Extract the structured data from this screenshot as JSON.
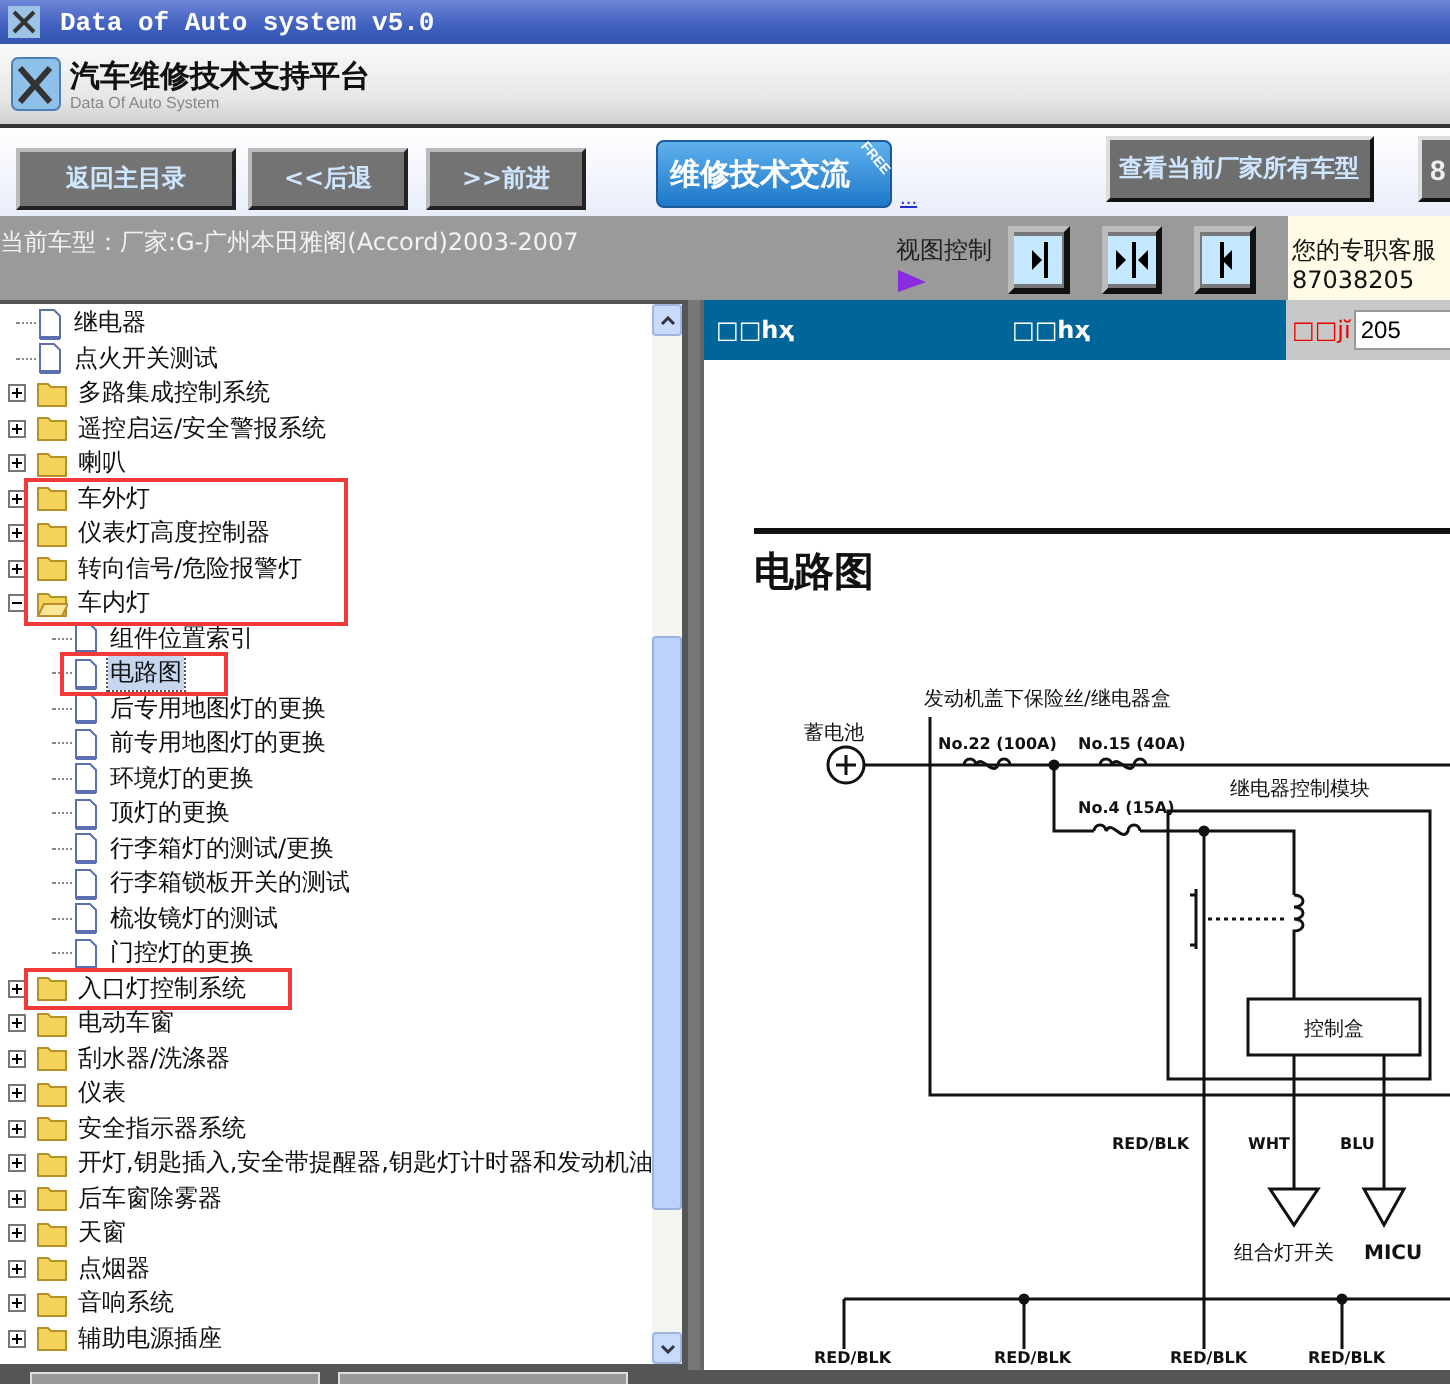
{
  "window": {
    "title": "Data of Auto system v5.0"
  },
  "header": {
    "title": "汽车维修技术支持平台",
    "subtitle": "Data Of Auto System"
  },
  "toolbar": {
    "buttons": [
      {
        "label": "返回主目录",
        "kind": "nav"
      },
      {
        "label": "<<后退",
        "kind": "nav"
      },
      {
        "label": ">>前进",
        "kind": "nav"
      },
      {
        "label": "维修技术交流",
        "kind": "promo",
        "badge": "FREE"
      },
      {
        "label": "...",
        "kind": "link"
      },
      {
        "label": "查看当前厂家所有车型",
        "kind": "wide"
      },
      {
        "label": "8",
        "kind": "cut"
      }
    ]
  },
  "info_bar": {
    "current_model": "当前车型：厂家:G-广州本田雅阁(Accord)2003-2007",
    "view_control_label": "视图控制",
    "view_buttons": [
      {
        "kind": "expand_right"
      },
      {
        "kind": "split"
      },
      {
        "kind": "expand_left"
      }
    ],
    "service": {
      "label": "您的专职客服",
      "phone": "87038205"
    }
  },
  "tree": {
    "items": [
      {
        "label": "继电器",
        "kind": "doc",
        "selected": false,
        "marked": false
      },
      {
        "label": "点火开关测试",
        "kind": "doc",
        "selected": false,
        "marked": false
      },
      {
        "label": "多路集成控制系统",
        "kind": "folder",
        "expanded": false,
        "selected": false,
        "marked": false
      },
      {
        "label": "遥控启运/安全警报系统",
        "kind": "folder",
        "expanded": false,
        "selected": false,
        "marked": false
      },
      {
        "label": "喇叭",
        "kind": "folder",
        "expanded": false,
        "selected": false,
        "marked": false
      },
      {
        "label": "车外灯",
        "kind": "folder",
        "expanded": false,
        "selected": false,
        "marked": true
      },
      {
        "label": "仪表灯高度控制器",
        "kind": "folder",
        "expanded": false,
        "selected": false,
        "marked": true
      },
      {
        "label": "转向信号/危险报警灯",
        "kind": "folder",
        "expanded": false,
        "selected": false,
        "marked": true
      },
      {
        "label": "车内灯",
        "kind": "folder",
        "expanded": true,
        "selected": false,
        "marked": true,
        "children": [
          {
            "label": "组件位置索引",
            "kind": "doc",
            "selected": false,
            "marked": false
          },
          {
            "label": "电路图",
            "kind": "doc",
            "selected": true,
            "marked": true
          },
          {
            "label": "后专用地图灯的更换",
            "kind": "doc",
            "selected": false,
            "marked": false
          },
          {
            "label": "前专用地图灯的更换",
            "kind": "doc",
            "selected": false,
            "marked": false
          },
          {
            "label": "环境灯的更换",
            "kind": "doc",
            "selected": false,
            "marked": false
          },
          {
            "label": "顶灯的更换",
            "kind": "doc",
            "selected": false,
            "marked": false
          },
          {
            "label": "行李箱灯的测试/更换",
            "kind": "doc",
            "selected": false,
            "marked": false
          },
          {
            "label": "行李箱锁板开关的测试",
            "kind": "doc",
            "selected": false,
            "marked": false
          },
          {
            "label": "梳妆镜灯的测试",
            "kind": "doc",
            "selected": false,
            "marked": false
          },
          {
            "label": "门控灯的更换",
            "kind": "doc",
            "selected": false,
            "marked": false
          }
        ]
      },
      {
        "label": "入口灯控制系统",
        "kind": "folder",
        "expanded": false,
        "selected": false,
        "marked": true
      },
      {
        "label": "电动车窗",
        "kind": "folder",
        "expanded": false,
        "selected": false,
        "marked": false
      },
      {
        "label": "刮水器/洗涤器",
        "kind": "folder",
        "expanded": false,
        "selected": false,
        "marked": false
      },
      {
        "label": "仪表",
        "kind": "folder",
        "expanded": false,
        "selected": false,
        "marked": false
      },
      {
        "label": "安全指示器系统",
        "kind": "folder",
        "expanded": false,
        "selected": false,
        "marked": false
      },
      {
        "label": "开灯,钥匙插入,安全带提醒器,钥匙灯计时器和发动机油",
        "kind": "folder",
        "expanded": false,
        "selected": false,
        "marked": false
      },
      {
        "label": "后车窗除雾器",
        "kind": "folder",
        "expanded": false,
        "selected": false,
        "marked": false
      },
      {
        "label": "天窗",
        "kind": "folder",
        "expanded": false,
        "selected": false,
        "marked": false
      },
      {
        "label": "点烟器",
        "kind": "folder",
        "expanded": false,
        "selected": false,
        "marked": false
      },
      {
        "label": "音响系统",
        "kind": "folder",
        "expanded": false,
        "selected": false,
        "marked": false
      },
      {
        "label": "辅助电源插座",
        "kind": "folder",
        "expanded": false,
        "selected": false,
        "marked": false
      }
    ]
  },
  "viewer": {
    "header_texts": [
      "□□hҳ",
      "□□hҳ"
    ],
    "page_label": "□□jĭ",
    "page_value": "205",
    "diagram": {
      "title": "电路图",
      "fuse_box": "发动机盖下保险丝/继电器盒",
      "battery": "蓄电池",
      "fuses": [
        "No.22 (100A)",
        "No.15 (40A)",
        "No.4 (15A)"
      ],
      "module": "继电器控制模块",
      "control_box": "控制盒",
      "wires": [
        "RED/BLK",
        "WHT",
        "BLU"
      ],
      "loads": [
        "组合灯开关",
        "MICU"
      ],
      "ground_wires": [
        "RED/BLK",
        "RED/BLK",
        "RED/BLK",
        "RED/BLK"
      ]
    }
  }
}
